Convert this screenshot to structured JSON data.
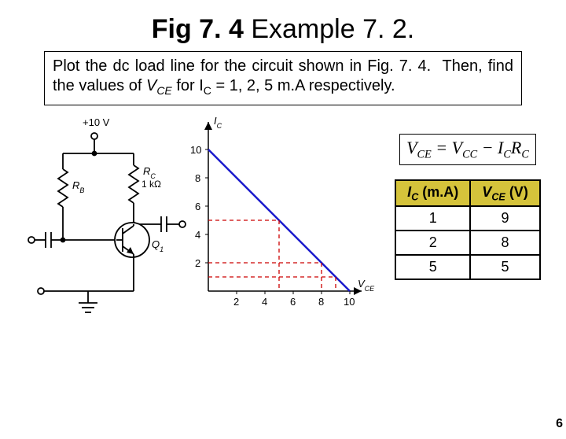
{
  "title_bold": "Fig 7. 4",
  "title_rest": " Example 7. 2.",
  "problem_html": "Plot the dc load line for the circuit shown in Fig. 7. 4.&nbsp;&nbsp;Then, find the values of <span class='it'>V<span class='sub'>CE</span></span> for I<span class='sub'>C</span> = 1, 2, 5 m.A respectively.",
  "circuit": {
    "vcc": "+10 V",
    "rb": "R",
    "rb_sub": "B",
    "rc": "R",
    "rc_sub": "C",
    "rc_val": "1 kΩ",
    "q": "Q",
    "q_sub": "1"
  },
  "equation": {
    "lhs": "V",
    "lhs_sub": "CE",
    "eq": " = ",
    "t1": "V",
    "t1_sub": "CC",
    "minus": " − ",
    "t2": "I",
    "t2_sub": "C",
    "t3": "R",
    "t3_sub": "C"
  },
  "table": {
    "col1_label": "I",
    "col1_sub": "C",
    "col1_unit": " (m.A)",
    "col2_label": "V",
    "col2_sub": "CE",
    "col2_unit": " (V)",
    "rows": [
      {
        "ic": "1",
        "vce": "9"
      },
      {
        "ic": "2",
        "vce": "8"
      },
      {
        "ic": "5",
        "vce": "5"
      }
    ]
  },
  "chart_data": {
    "type": "line",
    "xlabel": "V_CE",
    "ylabel": "I_C",
    "xlim": [
      0,
      11
    ],
    "ylim": [
      0,
      11
    ],
    "xticks": [
      2,
      4,
      6,
      8,
      10
    ],
    "yticks": [
      2,
      4,
      6,
      8,
      10
    ],
    "series": [
      {
        "name": "load-line",
        "xy": [
          [
            0,
            10
          ],
          [
            10,
            0
          ]
        ],
        "color": "#1a1acc"
      }
    ],
    "dashed_refs": [
      {
        "ic": 5,
        "vce": 5
      },
      {
        "ic": 2,
        "vce": 8
      },
      {
        "ic": 1,
        "vce": 9
      }
    ]
  },
  "page_number": "6"
}
